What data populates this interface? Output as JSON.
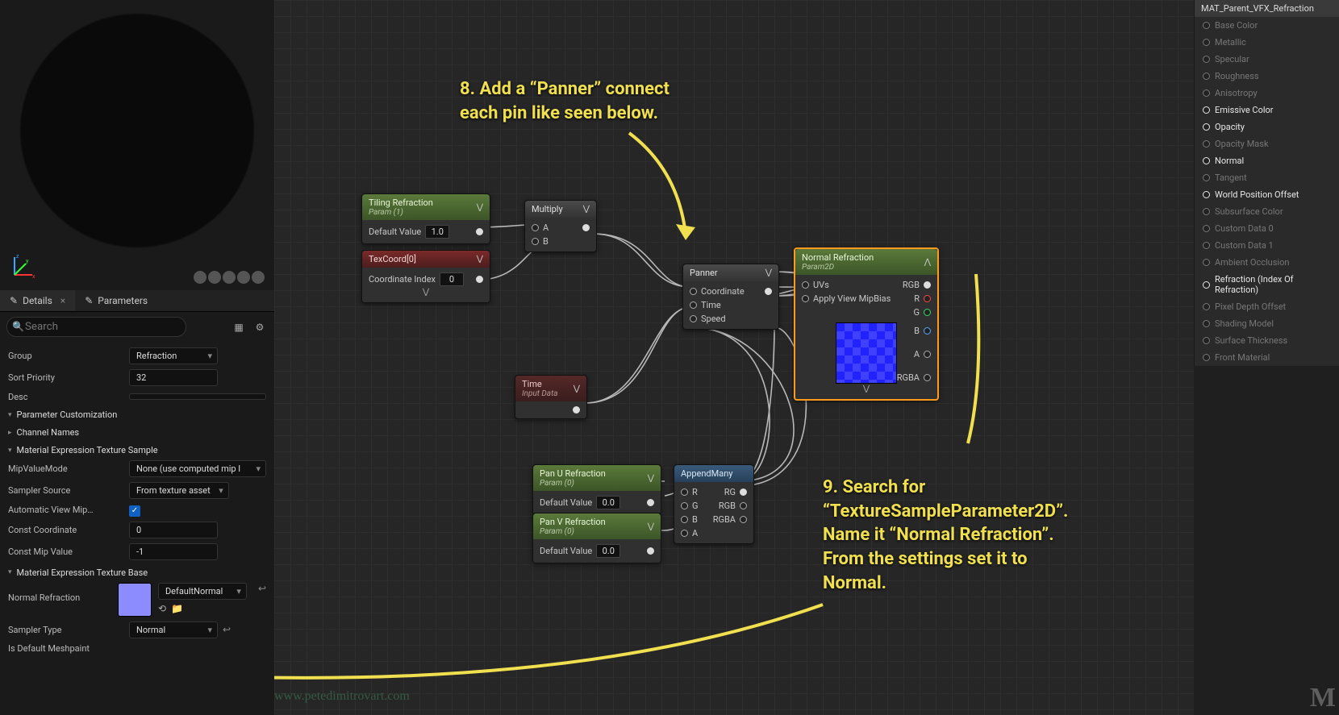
{
  "tabs": {
    "details": "Details",
    "parameters": "Parameters"
  },
  "search": {
    "placeholder": "Search"
  },
  "detailRows": {
    "group_lbl": "Group",
    "group_val": "Refraction",
    "sort_lbl": "Sort Priority",
    "sort_val": "32",
    "desc_lbl": "Desc",
    "sec_paramcust": "Parameter Customization",
    "sec_channel": "Channel Names",
    "sec_texsample": "Material Expression Texture Sample",
    "mip_lbl": "MipValueMode",
    "mip_val": "None (use computed mip l",
    "sampsrc_lbl": "Sampler Source",
    "sampsrc_val": "From texture asset",
    "autoview_lbl": "Automatic View Mip…",
    "constcoord_lbl": "Const Coordinate",
    "constcoord_val": "0",
    "constmip_lbl": "Const Mip Value",
    "constmip_val": "-1",
    "sec_texbase": "Material Expression Texture Base",
    "texname_lbl": "Normal Refraction",
    "texasset": "DefaultNormal",
    "samptype_lbl": "Sampler Type",
    "samptype_val": "Normal",
    "isdefault_lbl": "Is Default Meshpaint"
  },
  "rightPanel": {
    "title": "MAT_Parent_VFX_Refraction",
    "rows": [
      {
        "label": "Base Color",
        "dim": true
      },
      {
        "label": "Metallic",
        "dim": true
      },
      {
        "label": "Specular",
        "dim": true
      },
      {
        "label": "Roughness",
        "dim": true
      },
      {
        "label": "Anisotropy",
        "dim": true
      },
      {
        "label": "Emissive Color",
        "dim": false
      },
      {
        "label": "Opacity",
        "dim": false
      },
      {
        "label": "Opacity Mask",
        "dim": true
      },
      {
        "label": "Normal",
        "dim": false
      },
      {
        "label": "Tangent",
        "dim": true
      },
      {
        "label": "World Position Offset",
        "dim": false
      },
      {
        "label": "Subsurface Color",
        "dim": true
      },
      {
        "label": "Custom Data 0",
        "dim": true
      },
      {
        "label": "Custom Data 1",
        "dim": true
      },
      {
        "label": "Ambient Occlusion",
        "dim": true
      },
      {
        "label": "Refraction (Index Of Refraction)",
        "dim": false
      },
      {
        "label": "Pixel Depth Offset",
        "dim": true
      },
      {
        "label": "Shading Model",
        "dim": true
      },
      {
        "label": "Surface Thickness",
        "dim": true
      },
      {
        "label": "Front Material",
        "dim": true
      }
    ]
  },
  "nodes": {
    "tiling": {
      "title": "Tiling Refraction",
      "sub": "Param (1)",
      "dv_lbl": "Default Value",
      "dv": "1.0"
    },
    "texcoord": {
      "title": "TexCoord[0]",
      "ci_lbl": "Coordinate Index",
      "ci": "0"
    },
    "multiply": {
      "title": "Multiply",
      "a": "A",
      "b": "B"
    },
    "panner": {
      "title": "Panner",
      "p1": "Coordinate",
      "p2": "Time",
      "p3": "Speed"
    },
    "time": {
      "title": "Time",
      "sub": "Input Data"
    },
    "panu": {
      "title": "Pan U Refraction",
      "sub": "Param (0)",
      "dv_lbl": "Default Value",
      "dv": "0.0"
    },
    "panv": {
      "title": "Pan V Refraction",
      "sub": "Param (0)",
      "dv_lbl": "Default Value",
      "dv": "0.0"
    },
    "append": {
      "title": "AppendMany",
      "r": "R",
      "g": "G",
      "b": "B",
      "a": "A",
      "rg": "RG",
      "rgb": "RGB",
      "rgba": "RGBA"
    },
    "normal": {
      "title": "Normal Refraction",
      "sub": "Param2D",
      "uvs": "UVs",
      "mip": "Apply View MipBias",
      "rgb": "RGB",
      "r": "R",
      "g": "G",
      "b": "B",
      "a": "A",
      "rgba": "RGBA"
    }
  },
  "annotations": {
    "a8_l1": "8. Add a “Panner” connect",
    "a8_l2": "each pin like seen below.",
    "a9_l1": "9. Search for",
    "a9_l2": "“TextureSampleParameter2D”.",
    "a9_l3": "Name it “Normal Refraction”.",
    "a9_l4": "From the settings set it to",
    "a9_l5": "Normal."
  },
  "watermark": "www.petedimitrovart.com",
  "logo": "M"
}
